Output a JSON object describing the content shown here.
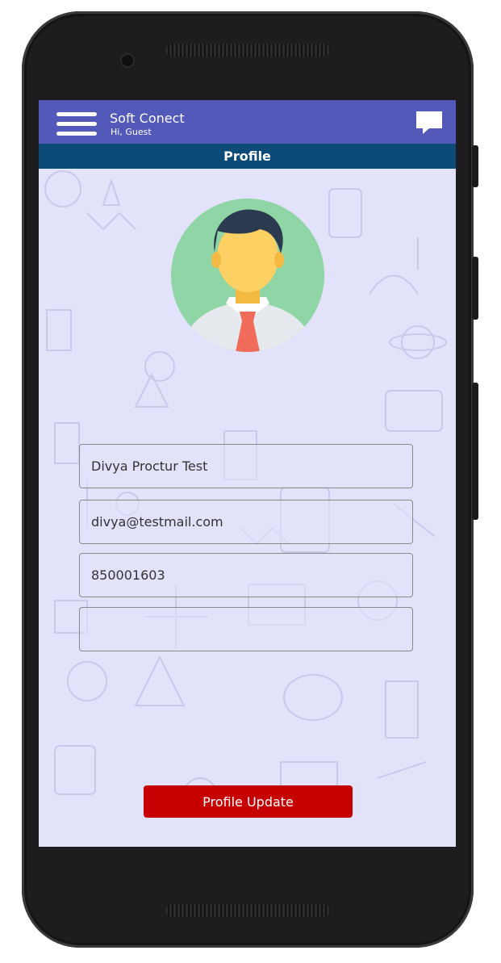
{
  "app": {
    "title": "Soft Conect",
    "greeting": "Hi, Guest"
  },
  "page": {
    "title": "Profile"
  },
  "form": {
    "name": "Divya Proctur Test",
    "email": "divya@testmail.com",
    "phone": "850001603",
    "address": ""
  },
  "actions": {
    "update_label": "Profile Update"
  },
  "colors": {
    "appbar": "#5259b9",
    "subbar": "#0c4a78",
    "button": "#c60000",
    "background": "#e2e2fa"
  },
  "icons": {
    "menu": "hamburger-menu-icon",
    "chat": "chat-bubble-icon",
    "avatar": "user-avatar-icon"
  }
}
